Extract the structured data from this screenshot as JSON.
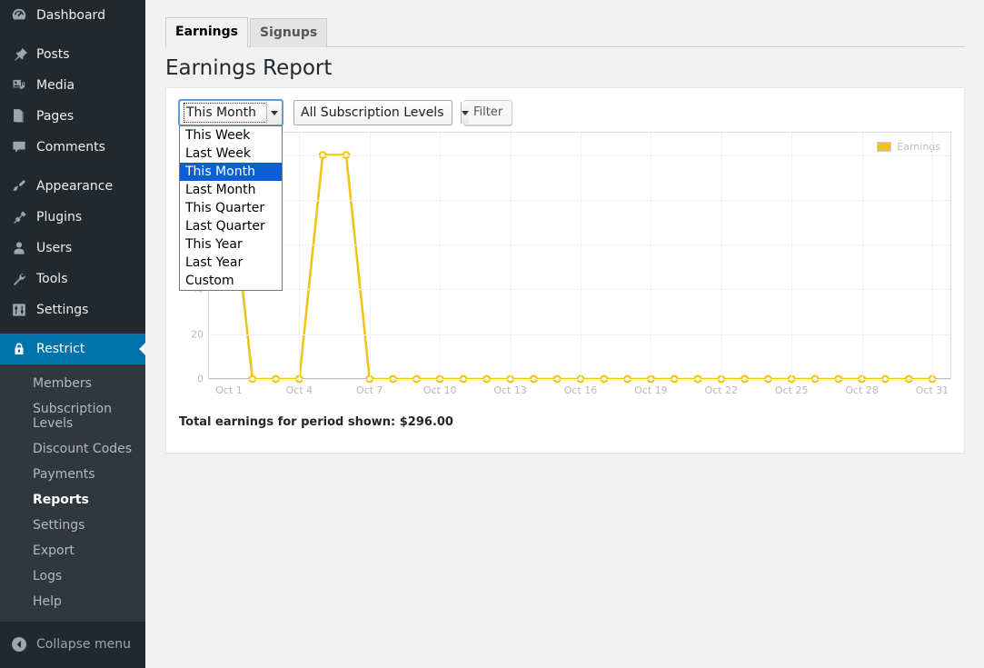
{
  "sidebar": {
    "items": [
      {
        "label": "Dashboard",
        "icon": "dashboard-icon",
        "sep_after": true
      },
      {
        "label": "Posts",
        "icon": "pin-icon"
      },
      {
        "label": "Media",
        "icon": "media-icon"
      },
      {
        "label": "Pages",
        "icon": "pages-icon"
      },
      {
        "label": "Comments",
        "icon": "comment-icon",
        "sep_after": true
      },
      {
        "label": "Appearance",
        "icon": "brush-icon"
      },
      {
        "label": "Plugins",
        "icon": "plug-icon"
      },
      {
        "label": "Users",
        "icon": "user-icon"
      },
      {
        "label": "Tools",
        "icon": "wrench-icon"
      },
      {
        "label": "Settings",
        "icon": "settings-icon",
        "sep_after": true
      },
      {
        "label": "Restrict",
        "icon": "lock-icon",
        "current": true
      }
    ],
    "submenu": [
      {
        "label": "Members"
      },
      {
        "label": "Subscription Levels"
      },
      {
        "label": "Discount Codes"
      },
      {
        "label": "Payments"
      },
      {
        "label": "Reports",
        "current": true
      },
      {
        "label": "Settings"
      },
      {
        "label": "Export"
      },
      {
        "label": "Logs"
      },
      {
        "label": "Help"
      }
    ],
    "collapse_label": "Collapse menu",
    "collapse_icon": "collapse-arrow-icon",
    "highlight_color": "#0073aa",
    "background_color": "#23282d",
    "submenu_background_color": "#32373c"
  },
  "tabs": [
    {
      "label": "Earnings",
      "active": true
    },
    {
      "label": "Signups",
      "active": false
    }
  ],
  "page_title": "Earnings Report",
  "filters": {
    "range_select": {
      "value": "This Month",
      "options": [
        "This Week",
        "Last Week",
        "This Month",
        "Last Month",
        "This Quarter",
        "Last Quarter",
        "This Year",
        "Last Year",
        "Custom"
      ],
      "selected_index": 2,
      "expanded": true,
      "focus_color": "#5b9dd9",
      "selected_option_color": "#0a5fd4"
    },
    "level_select": {
      "value": "All Subscription Levels"
    },
    "filter_button": "Filter"
  },
  "total_text": "Total earnings for period shown: $296.00",
  "chart_data": {
    "type": "line",
    "title": "",
    "xlabel": "",
    "ylabel": "",
    "series_color": "#f0c419",
    "legend": [
      "Earnings"
    ],
    "legend_position": "top-right",
    "grid": true,
    "ylim": [
      0,
      110
    ],
    "yticks": [
      0,
      20,
      40
    ],
    "ygridlines": [
      0,
      20,
      40,
      60,
      80,
      100
    ],
    "xticks": [
      "Oct 1",
      "Oct 4",
      "Oct 7",
      "Oct 10",
      "Oct 13",
      "Oct 16",
      "Oct 19",
      "Oct 22",
      "Oct 25",
      "Oct 28",
      "Oct 31"
    ],
    "categories": [
      "Oct 1",
      "Oct 2",
      "Oct 3",
      "Oct 4",
      "Oct 5",
      "Oct 6",
      "Oct 7",
      "Oct 8",
      "Oct 9",
      "Oct 10",
      "Oct 11",
      "Oct 12",
      "Oct 13",
      "Oct 14",
      "Oct 15",
      "Oct 16",
      "Oct 17",
      "Oct 18",
      "Oct 19",
      "Oct 20",
      "Oct 21",
      "Oct 22",
      "Oct 23",
      "Oct 24",
      "Oct 25",
      "Oct 26",
      "Oct 27",
      "Oct 28",
      "Oct 29",
      "Oct 30",
      "Oct 31"
    ],
    "series": [
      {
        "name": "Earnings",
        "values": [
          96,
          0,
          0,
          0,
          100,
          100,
          0,
          0,
          0,
          0,
          0,
          0,
          0,
          0,
          0,
          0,
          0,
          0,
          0,
          0,
          0,
          0,
          0,
          0,
          0,
          0,
          0,
          0,
          0,
          0,
          0
        ]
      }
    ]
  }
}
